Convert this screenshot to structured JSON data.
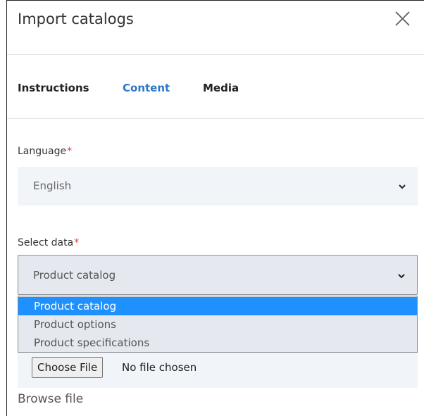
{
  "modal": {
    "title": "Import catalogs"
  },
  "tabs": [
    {
      "label": "Instructions"
    },
    {
      "label": "Content"
    },
    {
      "label": "Media"
    }
  ],
  "language": {
    "label": "Language",
    "required_mark": "*",
    "value": "English"
  },
  "select_data": {
    "label": "Select data",
    "required_mark": "*",
    "value": "Product catalog",
    "options": [
      {
        "label": "Product catalog",
        "selected": true
      },
      {
        "label": "Product options",
        "selected": false
      },
      {
        "label": "Product specifications",
        "selected": false
      }
    ]
  },
  "file_input": {
    "button_label": "Choose File",
    "status": "No file chosen"
  },
  "browse_label": "Browse file",
  "colors": {
    "accent_tab": "#2a78c9",
    "required": "#e53945",
    "highlight": "#1e90ff",
    "field_bg": "#f1f4f8"
  }
}
